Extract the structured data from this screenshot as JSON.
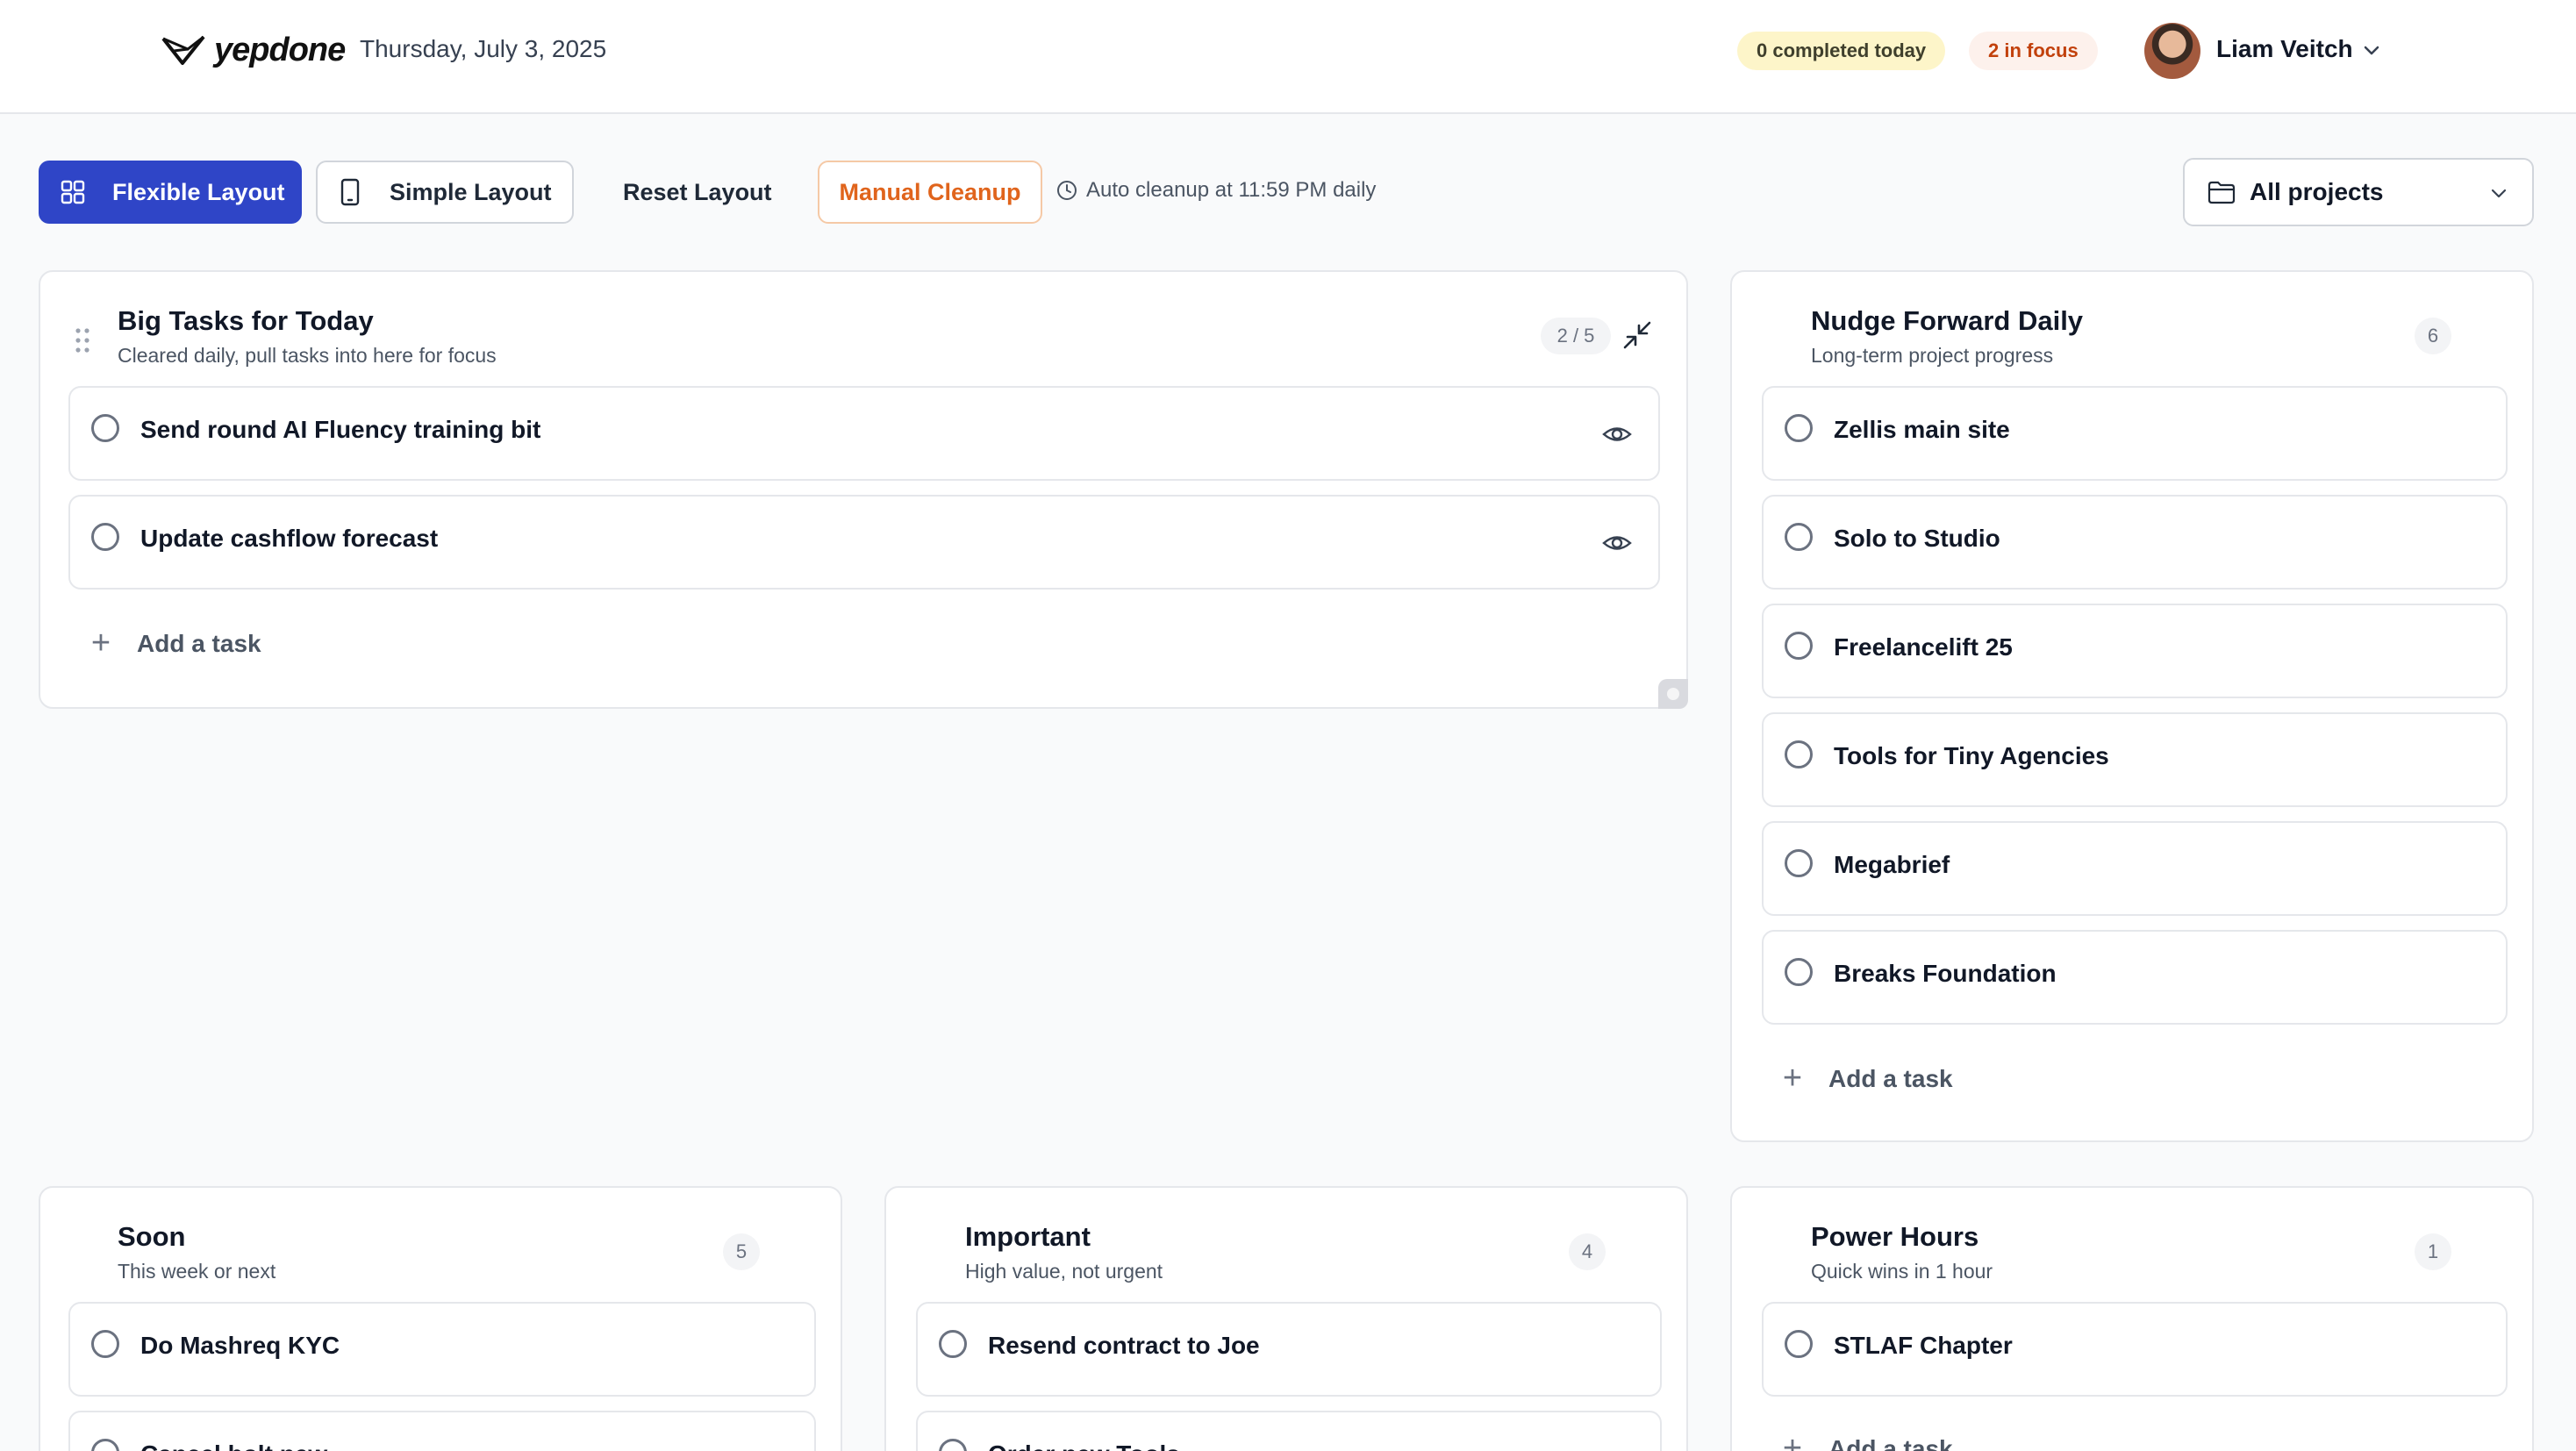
{
  "header": {
    "brand": "yepdone",
    "date": "Thursday, July 3, 2025",
    "completed_badge": "0 completed today",
    "focus_badge": "2 in focus",
    "user_name": "Liam Veitch"
  },
  "toolbar": {
    "flexible_layout": "Flexible Layout",
    "simple_layout": "Simple Layout",
    "reset_layout": "Reset Layout",
    "manual_cleanup": "Manual Cleanup",
    "auto_cleanup_note": "Auto cleanup at 11:59 PM daily",
    "projects_select": "All projects"
  },
  "panels": {
    "big_tasks": {
      "title": "Big Tasks for Today",
      "subtitle": "Cleared daily, pull tasks into here for focus",
      "count": "2 / 5",
      "tasks": [
        "Send round AI Fluency training bit",
        "Update cashflow forecast"
      ],
      "add_label": "Add a task"
    },
    "nudge": {
      "title": "Nudge Forward Daily",
      "subtitle": "Long-term project progress",
      "count": "6",
      "tasks": [
        "Zellis main site",
        "Solo to Studio",
        "Freelancelift 25",
        "Tools for Tiny Agencies",
        "Megabrief",
        "Breaks Foundation"
      ],
      "add_label": "Add a task"
    },
    "soon": {
      "title": "Soon",
      "subtitle": "This week or next",
      "count": "5",
      "tasks": [
        "Do Mashreq KYC",
        "Cancel bolt.new"
      ]
    },
    "important": {
      "title": "Important",
      "subtitle": "High value, not urgent",
      "count": "4",
      "tasks": [
        "Resend contract to Joe",
        "Order new Tools"
      ]
    },
    "power_hours": {
      "title": "Power Hours",
      "subtitle": "Quick wins in 1 hour",
      "count": "1",
      "tasks": [
        "STLAF Chapter"
      ],
      "add_label": "Add a task"
    }
  }
}
